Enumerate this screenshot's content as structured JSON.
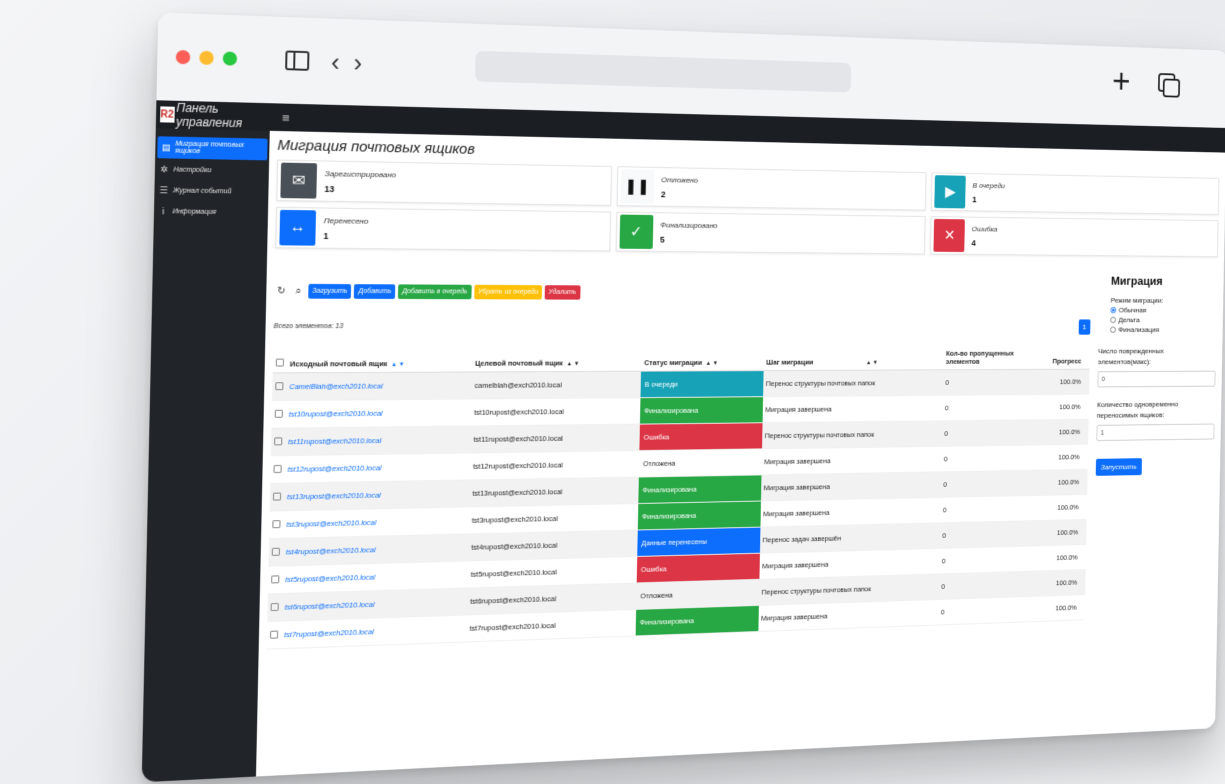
{
  "brand": {
    "logo": "R2",
    "title": "Панель управления"
  },
  "sidebar": {
    "items": [
      {
        "label": "Миграция почтовых ящиков",
        "icon": "mailbox-icon",
        "active": true
      },
      {
        "label": "Настройки",
        "icon": "gear-icon",
        "active": false
      },
      {
        "label": "Журнал событий",
        "icon": "list-icon",
        "active": false
      },
      {
        "label": "Информация",
        "icon": "info-icon",
        "active": false
      }
    ]
  },
  "page": {
    "title": "Миграция почтовых ящиков"
  },
  "cards": [
    {
      "label": "Зарегистрировано",
      "count": "13",
      "color": "#495057",
      "icon": "envelope-icon",
      "glyph": "✉"
    },
    {
      "label": "Отложено",
      "count": "2",
      "color": "#f8f9fa",
      "icon": "pause-icon",
      "glyph": "❚❚"
    },
    {
      "label": "В очереди",
      "count": "1",
      "color": "#17a2b8",
      "icon": "play-icon",
      "glyph": "▶"
    },
    {
      "label": "Перенесено",
      "count": "1",
      "color": "#0d6efd",
      "icon": "arrows-icon",
      "glyph": "↔"
    },
    {
      "label": "Финализировано",
      "count": "5",
      "color": "#28a745",
      "icon": "check-icon",
      "glyph": "✓"
    },
    {
      "label": "Ошибка",
      "count": "4",
      "color": "#dc3545",
      "icon": "x-icon",
      "glyph": "✕"
    }
  ],
  "toolbar": {
    "load": "Загрузить",
    "add": "Добавить",
    "add_queue": "Добавить в очередь",
    "remove_queue": "Убрать из очереди",
    "delete": "Удалить"
  },
  "table": {
    "total": "Всего элементов: 13",
    "page": "1",
    "headers": {
      "source": "Исходный почтовый ящик",
      "target": "Целевой почтовый ящик",
      "status": "Статус миграции",
      "step": "Шаг миграции",
      "skipped": "Кол-во пропущенных элементов",
      "progress": "Прогресс"
    },
    "rows": [
      {
        "source": "CamelBlah@exch2010.local",
        "target": "camelblah@exch2010.local",
        "status": "В очереди",
        "status_color": "#17a2b8",
        "step": "Перенос структуры почтовых папок",
        "skipped": "0",
        "progress": "100.0%"
      },
      {
        "source": "tst10rupost@exch2010.local",
        "target": "tst10rupost@exch2010.local",
        "status": "Финализирована",
        "status_color": "#28a745",
        "step": "Миграция завершена",
        "skipped": "0",
        "progress": "100.0%"
      },
      {
        "source": "tst11rupost@exch2010.local",
        "target": "tst11rupost@exch2010.local",
        "status": "Ошибка",
        "status_color": "#dc3545",
        "step": "Перенос структуры почтовых папок",
        "skipped": "0",
        "progress": "100.0%"
      },
      {
        "source": "tst12rupost@exch2010.local",
        "target": "tst12rupost@exch2010.local",
        "status": "Отложена",
        "status_color": "",
        "step": "Миграция завершена",
        "skipped": "0",
        "progress": "100.0%"
      },
      {
        "source": "tst13rupost@exch2010.local",
        "target": "tst13rupost@exch2010.local",
        "status": "Финализирована",
        "status_color": "#28a745",
        "step": "Миграция завершена",
        "skipped": "0",
        "progress": "100.0%"
      },
      {
        "source": "tst3rupost@exch2010.local",
        "target": "tst3rupost@exch2010.local",
        "status": "Финализирована",
        "status_color": "#28a745",
        "step": "Миграция завершена",
        "skipped": "0",
        "progress": "100.0%"
      },
      {
        "source": "tst4rupost@exch2010.local",
        "target": "tst4rupost@exch2010.local",
        "status": "Данные перенесены",
        "status_color": "#0d6efd",
        "step": "Перенос задач завершён",
        "skipped": "0",
        "progress": "100.0%"
      },
      {
        "source": "tst5rupost@exch2010.local",
        "target": "tst5rupost@exch2010.local",
        "status": "Ошибка",
        "status_color": "#dc3545",
        "step": "Миграция завершена",
        "skipped": "0",
        "progress": "100.0%"
      },
      {
        "source": "tst6rupost@exch2010.local",
        "target": "tst6rupost@exch2010.local",
        "status": "Отложена",
        "status_color": "",
        "step": "Перенос структуры почтовых папок",
        "skipped": "0",
        "progress": "100.0%"
      },
      {
        "source": "tst7rupost@exch2010.local",
        "target": "tst7rupost@exch2010.local",
        "status": "Финализирована",
        "status_color": "#28a745",
        "step": "Миграция завершена",
        "skipped": "0",
        "progress": "100.0%"
      }
    ]
  },
  "panel": {
    "title": "Миграция",
    "mode_label": "Режим миграции:",
    "modes": [
      {
        "label": "Обычная",
        "checked": true
      },
      {
        "label": "Дельта",
        "checked": false
      },
      {
        "label": "Финализация",
        "checked": false
      }
    ],
    "damaged_label": "Число поврежденных элементов(макс):",
    "damaged_value": "0",
    "concurrent_label": "Количество одновременно переносимых ящиков:",
    "concurrent_value": "1",
    "run": "Запустить"
  }
}
